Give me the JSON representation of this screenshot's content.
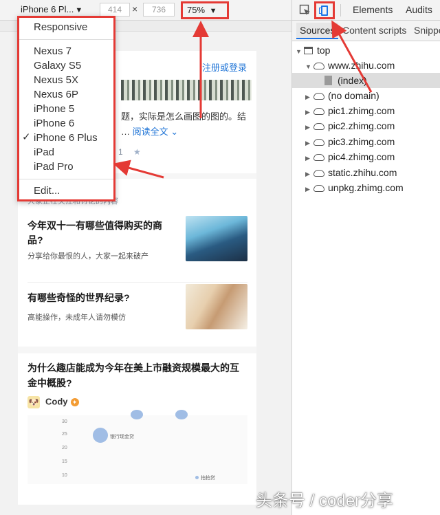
{
  "device_toolbar": {
    "device_label": "iPhone 6 Pl...",
    "width": "414",
    "height": "736",
    "times": "×",
    "zoom": "75%"
  },
  "dropdown": {
    "items": [
      "Responsive",
      "Nexus 7",
      "Galaxy S5",
      "Nexus 5X",
      "Nexus 6P",
      "iPhone 5",
      "iPhone 6",
      "iPhone 6 Plus",
      "iPad",
      "iPad Pro",
      "Edit..."
    ],
    "selected": "iPhone 6 Plus",
    "check": "✓"
  },
  "page": {
    "login_link": "注册或登录",
    "excerpt_line1": "题，实际是怎么画图的图的。结",
    "excerpt_prefix": "…",
    "read_more": "阅读全文 ⌄",
    "meta_count": "1",
    "meta_star": "★",
    "section_hint": "大家正在关注和讨论的内容",
    "questions": [
      {
        "title": "今年双十一有哪些值得购买的商品?",
        "sub": "分享给你最恨的人，大家一起来破产"
      },
      {
        "title": "有哪些奇怪的世界纪录?",
        "sub": "高能操作，未成年人请勿模仿"
      }
    ],
    "article_title": "为什么趣店能成为今年在美上市融资规模最大的互金中概股?",
    "author": "Cody",
    "author_avatar": "🐶",
    "author_badge": "✦",
    "chart_labels": [
      "30",
      "25",
      "20",
      "15",
      "10"
    ],
    "bubble_label_1": "银行现金贷",
    "bubble_label_2": "拍拍贷"
  },
  "devtools": {
    "tabs": [
      "Elements",
      "Audits"
    ],
    "sub_tabs": [
      "Sources",
      "Content scripts",
      "Snippe"
    ],
    "tree": [
      {
        "label": "top",
        "type": "frame",
        "arrow": "▼",
        "indent": 0
      },
      {
        "label": "www.zhihu.com",
        "type": "cloud",
        "arrow": "▼",
        "indent": 1
      },
      {
        "label": "(index)",
        "type": "file",
        "arrow": "",
        "indent": 2
      },
      {
        "label": "(no domain)",
        "type": "cloud",
        "arrow": "▶",
        "indent": 1
      },
      {
        "label": "pic1.zhimg.com",
        "type": "cloud",
        "arrow": "▶",
        "indent": 1
      },
      {
        "label": "pic2.zhimg.com",
        "type": "cloud",
        "arrow": "▶",
        "indent": 1
      },
      {
        "label": "pic3.zhimg.com",
        "type": "cloud",
        "arrow": "▶",
        "indent": 1
      },
      {
        "label": "pic4.zhimg.com",
        "type": "cloud",
        "arrow": "▶",
        "indent": 1
      },
      {
        "label": "static.zhihu.com",
        "type": "cloud",
        "arrow": "▶",
        "indent": 1
      },
      {
        "label": "unpkg.zhimg.com",
        "type": "cloud",
        "arrow": "▶",
        "indent": 1
      }
    ]
  },
  "watermark": "头条号 / coder分享",
  "colors": {
    "highlight": "#e43a35",
    "link": "#1f74d6",
    "accent": "#1a73e8"
  }
}
